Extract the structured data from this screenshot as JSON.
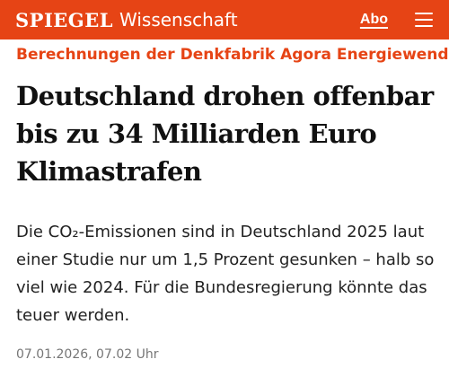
{
  "header": {
    "logo": "SPIEGEL",
    "section": "Wissenschaft",
    "abo_label": "Abo",
    "menu_icon": "hamburger-menu-icon",
    "background_color": "#e64415"
  },
  "article": {
    "kicker": "Berechnungen der Denkfabrik Agora Energiewende",
    "headline": "Deutschland drohen offenbar bis zu 34 Milliarden Euro Klimastrafen",
    "teaser": "Die CO₂-Emissionen sind in Deutschland 2025 laut einer Studie nur um 1,5 Prozent gesunken – halb so viel wie 2024. Für die Bundesregierung könnte das teuer werden.",
    "date": "07.01.2026, 07.02 Uhr",
    "kicker_color": "#e64415"
  }
}
